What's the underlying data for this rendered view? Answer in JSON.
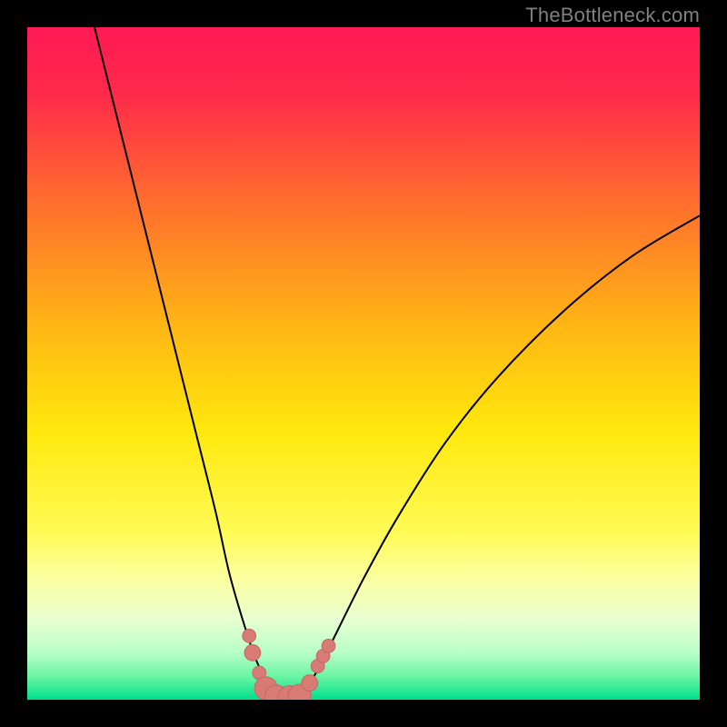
{
  "watermark": {
    "text": "TheBottleneck.com"
  },
  "colors": {
    "frame": "#000000",
    "gradient_stops": [
      {
        "offset": 0.0,
        "color": "#ff1a55"
      },
      {
        "offset": 0.1,
        "color": "#ff2a4a"
      },
      {
        "offset": 0.25,
        "color": "#ff6a2f"
      },
      {
        "offset": 0.45,
        "color": "#ffb814"
      },
      {
        "offset": 0.6,
        "color": "#ffe80d"
      },
      {
        "offset": 0.75,
        "color": "#fffb55"
      },
      {
        "offset": 0.82,
        "color": "#fbffa0"
      },
      {
        "offset": 0.88,
        "color": "#e8ffd0"
      },
      {
        "offset": 0.93,
        "color": "#b8ffc8"
      },
      {
        "offset": 0.965,
        "color": "#6cf5a4"
      },
      {
        "offset": 1.0,
        "color": "#00e08c"
      }
    ],
    "curve": "#000000",
    "marker_fill": "#d77b74",
    "marker_stroke": "#c46862"
  },
  "chart_data": {
    "type": "line",
    "title": "",
    "xlabel": "",
    "ylabel": "",
    "xlim": [
      0,
      100
    ],
    "ylim": [
      0,
      100
    ],
    "series": [
      {
        "name": "bottleneck-curve",
        "x": [
          10,
          13,
          16,
          19,
          22,
          25,
          28,
          30,
          32,
          34,
          36,
          37,
          38,
          39,
          40,
          42,
          44,
          46,
          50,
          55,
          62,
          70,
          80,
          90,
          100
        ],
        "y": [
          100,
          88,
          76,
          64,
          52,
          40,
          28,
          19,
          12,
          6,
          2,
          0.8,
          0.2,
          0.2,
          0.8,
          2.5,
          6,
          10,
          18,
          27,
          38,
          48,
          58,
          66,
          72
        ]
      }
    ],
    "markers": [
      {
        "x": 33.0,
        "y": 9.5,
        "r": 1.0
      },
      {
        "x": 33.5,
        "y": 7.0,
        "r": 1.2
      },
      {
        "x": 34.5,
        "y": 4.0,
        "r": 1.0
      },
      {
        "x": 35.5,
        "y": 1.7,
        "r": 1.7
      },
      {
        "x": 37.0,
        "y": 0.5,
        "r": 1.7
      },
      {
        "x": 39.0,
        "y": 0.4,
        "r": 1.7
      },
      {
        "x": 40.5,
        "y": 0.6,
        "r": 1.7
      },
      {
        "x": 42.0,
        "y": 2.5,
        "r": 1.2
      },
      {
        "x": 43.2,
        "y": 5.0,
        "r": 1.0
      },
      {
        "x": 44.0,
        "y": 6.5,
        "r": 1.0
      },
      {
        "x": 44.8,
        "y": 8.0,
        "r": 1.0
      }
    ]
  }
}
